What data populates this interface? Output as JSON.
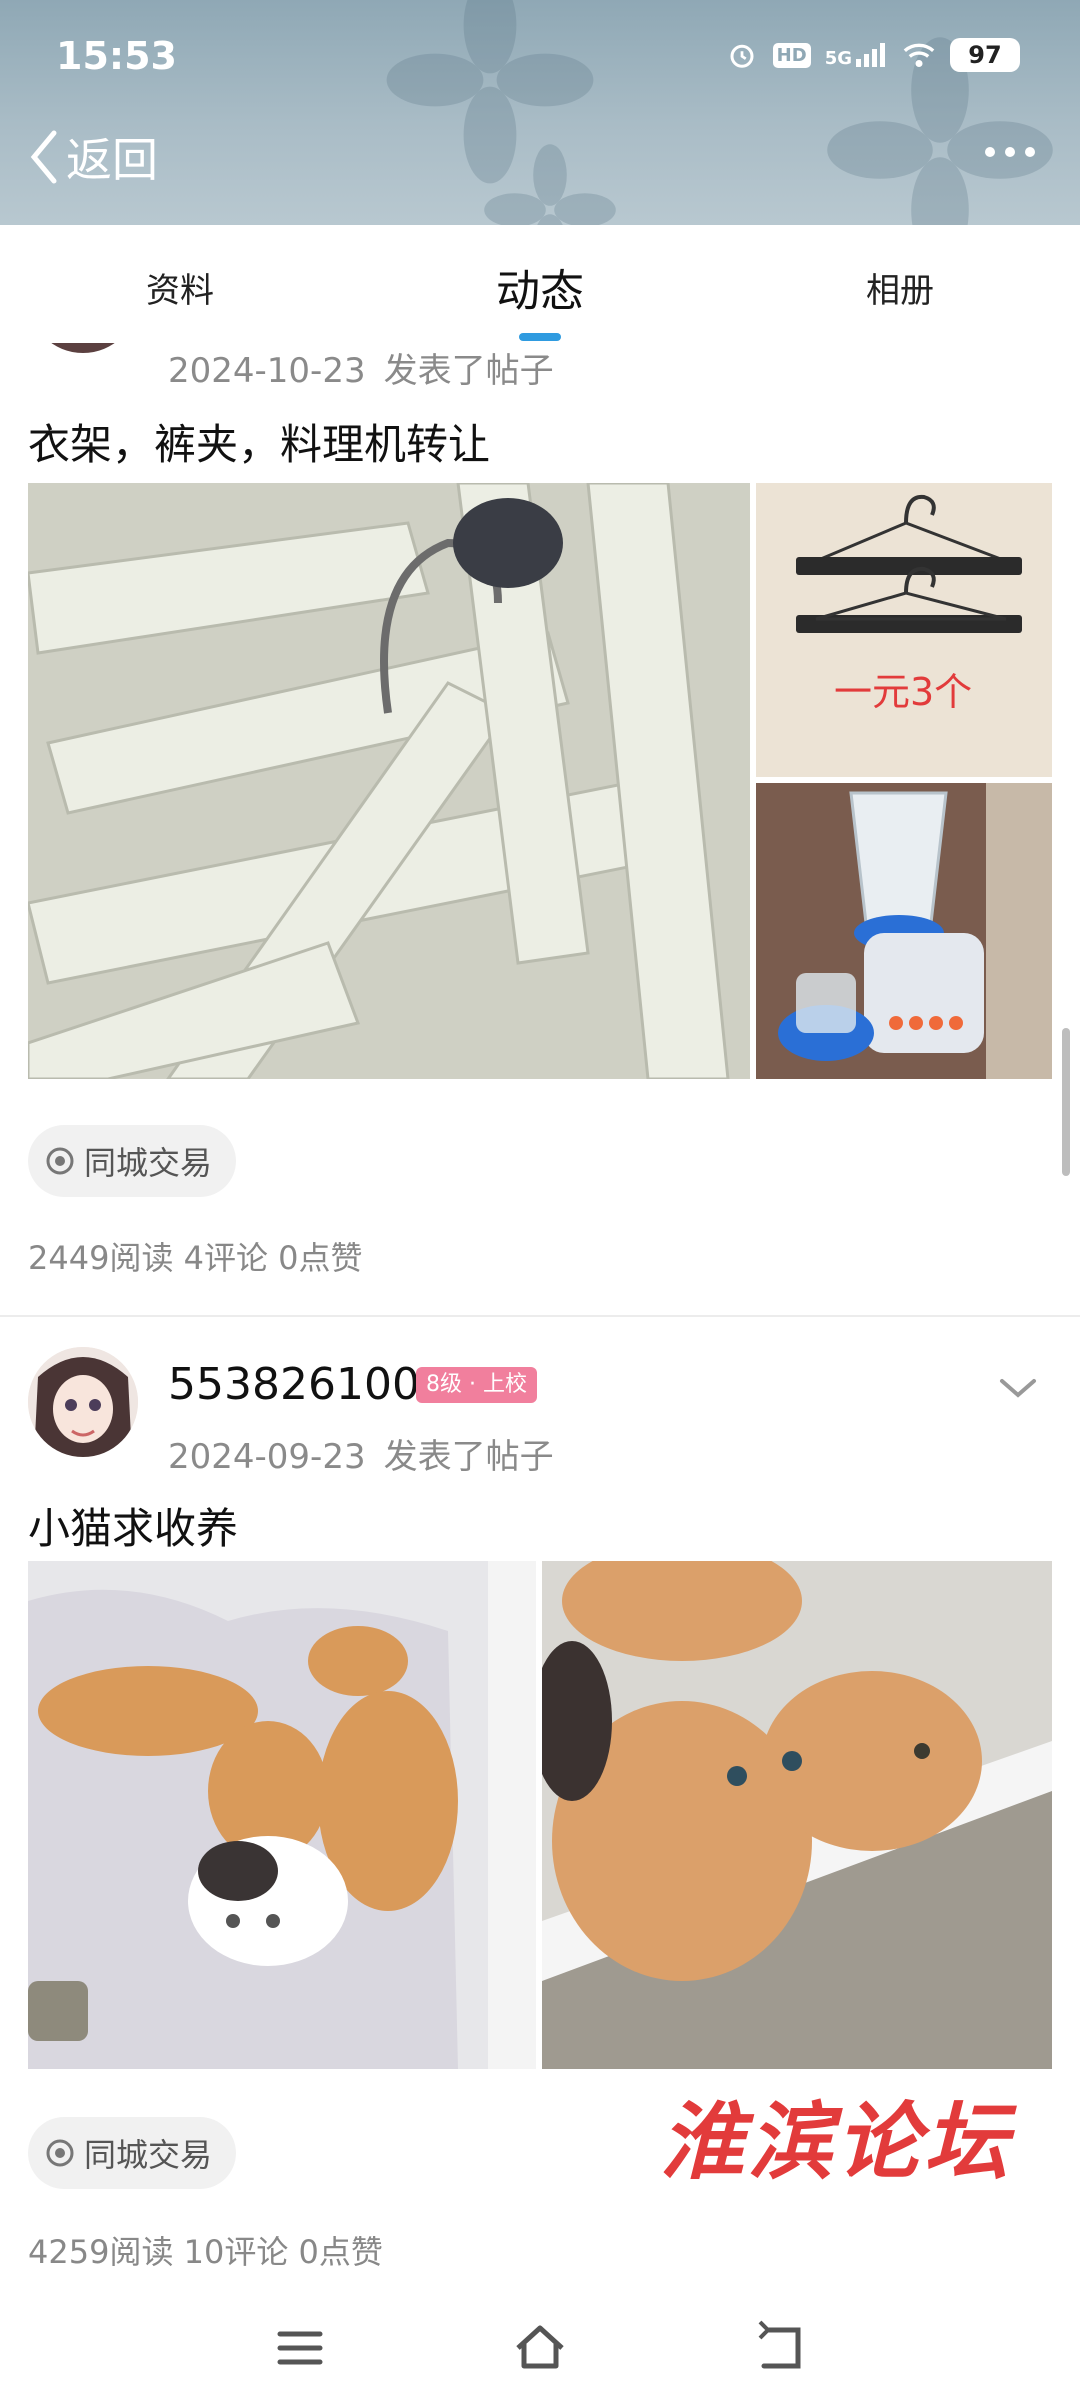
{
  "status_bar": {
    "time": "15:53",
    "network": "5G",
    "hd": "HD",
    "battery": "97"
  },
  "nav": {
    "back_label": "返回"
  },
  "tabs": [
    {
      "label": "资料",
      "active": false
    },
    {
      "label": "动态",
      "active": true
    },
    {
      "label": "相册",
      "active": false
    }
  ],
  "posts": [
    {
      "date": "2024-10-23",
      "action": "发表了帖子",
      "title": "衣架，裤夹，料理机转让",
      "image_caption": "一元3个",
      "tag": "同城交易",
      "stats": "2449阅读 4评论 0点赞"
    },
    {
      "username": "553826100",
      "level": "8级 · 上校",
      "date": "2024-09-23",
      "action": "发表了帖子",
      "title": "小猫求收养",
      "tag": "同城交易",
      "stats": "4259阅读 10评论 0点赞"
    }
  ],
  "watermark": "淮滨论坛",
  "colors": {
    "accent": "#2f9be0",
    "badge": "#f17f9d",
    "watermark": "#e23b3b"
  }
}
